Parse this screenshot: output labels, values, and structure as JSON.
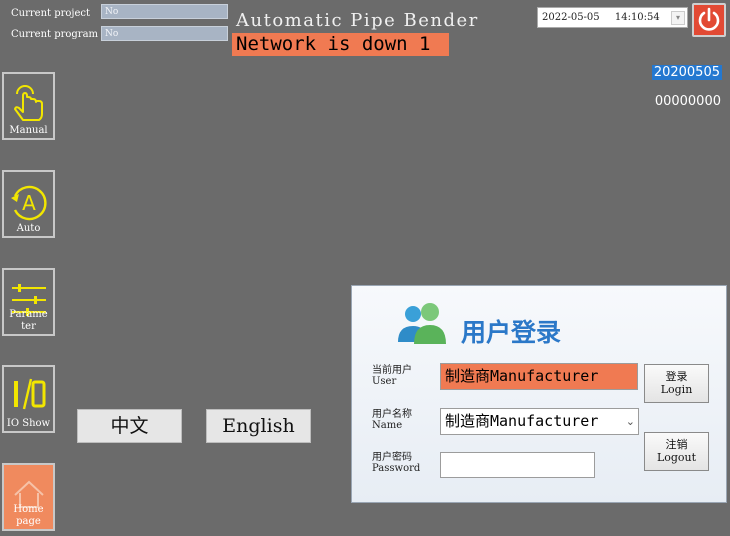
{
  "header": {
    "current_project_label": "Current project",
    "current_project_value": "No",
    "current_program_label": "Current program",
    "current_program_value": "No",
    "app_title": "Automatic Pipe Bender",
    "status_banner": "Network is down 1",
    "date": "2022-05-05",
    "time": "14:10:54",
    "power_icon": "power-icon",
    "code_a": "20200505",
    "code_b": "00000000"
  },
  "sidebar": {
    "items": [
      {
        "label": "Manual",
        "icon": "hand-pointer-icon"
      },
      {
        "label": "Auto",
        "icon": "auto-a-icon"
      },
      {
        "label_line1": "Parame",
        "label_line2": "ter",
        "icon": "sliders-icon"
      },
      {
        "label": "IO Show",
        "icon": "io-icon"
      },
      {
        "label_line1": "Home",
        "label_line2": "page",
        "icon": "home-icon"
      }
    ]
  },
  "language": {
    "chinese": "中文",
    "english": "English"
  },
  "login": {
    "title": "用户登录",
    "current_user_cn": "当前用户",
    "current_user_en": "User",
    "current_user_value": "制造商Manufacturer",
    "name_cn": "用户名称",
    "name_en": "Name",
    "name_value": "制造商Manufacturer",
    "password_cn": "用户密码",
    "password_en": "Password",
    "password_value": "",
    "login_cn": "登录",
    "login_en": "Login",
    "logout_cn": "注销",
    "logout_en": "Logout"
  },
  "colors": {
    "background": "#6b6b6b",
    "accent_orange": "#f07a52",
    "icon_yellow": "#f2e600",
    "power_red": "#e24a34",
    "dialog_title_blue": "#2b78c8"
  }
}
